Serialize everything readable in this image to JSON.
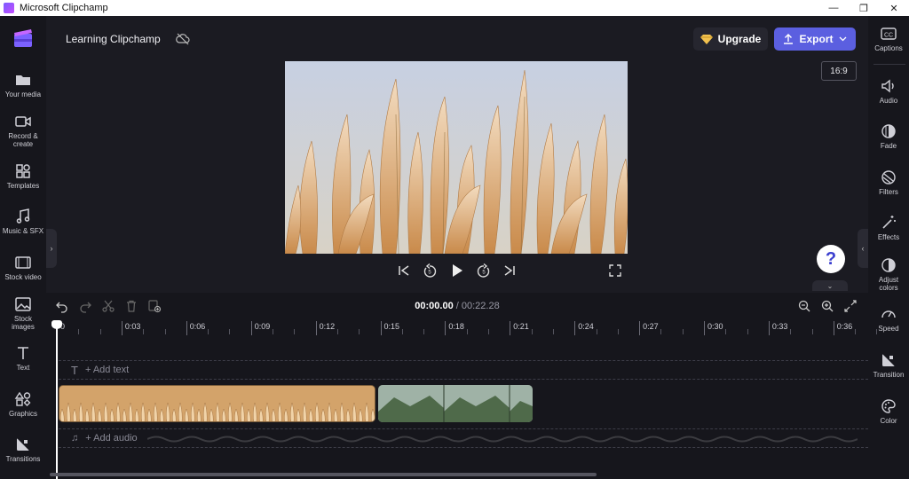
{
  "window": {
    "title": "Microsoft Clipchamp",
    "minimize": "—",
    "restore": "❐",
    "close": "✕"
  },
  "header": {
    "project_title": "Learning Clipchamp",
    "upgrade_label": "Upgrade",
    "export_label": "Export",
    "aspect_ratio": "16:9"
  },
  "left_nav": [
    {
      "label": "Your media",
      "icon": "folder-icon"
    },
    {
      "label": "Record &\ncreate",
      "icon": "camera-icon"
    },
    {
      "label": "Templates",
      "icon": "templates-icon"
    },
    {
      "label": "Music & SFX",
      "icon": "music-icon"
    },
    {
      "label": "Stock video",
      "icon": "film-icon"
    },
    {
      "label": "Stock\nimages",
      "icon": "image-icon"
    },
    {
      "label": "Text",
      "icon": "text-icon"
    },
    {
      "label": "Graphics",
      "icon": "shapes-icon"
    },
    {
      "label": "Transitions",
      "icon": "transitions-icon"
    }
  ],
  "right_nav": [
    {
      "label": "Captions",
      "icon": "captions-icon"
    },
    {
      "label": "Audio",
      "icon": "speaker-icon"
    },
    {
      "label": "Fade",
      "icon": "fade-icon"
    },
    {
      "label": "Filters",
      "icon": "filters-icon"
    },
    {
      "label": "Effects",
      "icon": "magic-wand-icon"
    },
    {
      "label": "Adjust\ncolors",
      "icon": "contrast-icon"
    },
    {
      "label": "Speed",
      "icon": "speedometer-icon"
    },
    {
      "label": "Transition",
      "icon": "transition-icon"
    },
    {
      "label": "Color",
      "icon": "palette-icon"
    }
  ],
  "help": {
    "label": "?"
  },
  "timeline": {
    "current_time": "00:00.00",
    "separator": " / ",
    "total_time": "00:22.28",
    "ruler": [
      "0",
      "0:03",
      "0:06",
      "0:09",
      "0:12",
      "0:15",
      "0:18",
      "0:21",
      "0:24",
      "0:27",
      "0:30",
      "0:33",
      "0:36"
    ],
    "add_text": "+ Add text",
    "add_audio": "+ Add audio"
  },
  "colors": {
    "accent": "#5b5fe0",
    "background": "#1b1b22",
    "sidebar": "#16161c"
  }
}
